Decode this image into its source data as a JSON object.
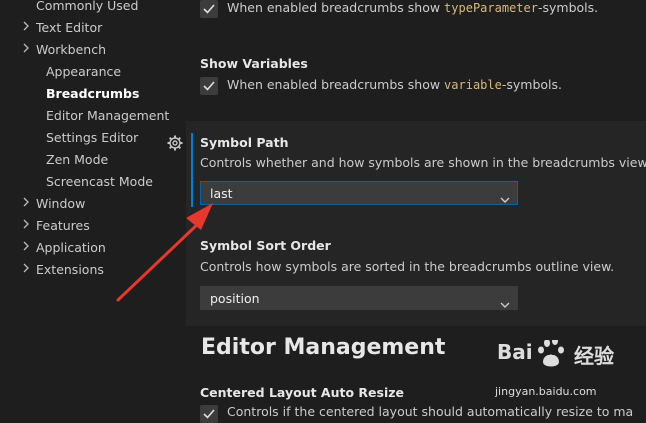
{
  "toc": {
    "items": [
      {
        "label": "Commonly Used",
        "indent": 1,
        "expandable": false
      },
      {
        "label": "Text Editor",
        "indent": 1,
        "expandable": true
      },
      {
        "label": "Workbench",
        "indent": 1,
        "expandable": true
      },
      {
        "label": "Appearance",
        "indent": 2,
        "expandable": false
      },
      {
        "label": "Breadcrumbs",
        "indent": 2,
        "expandable": false,
        "active": true
      },
      {
        "label": "Editor Management",
        "indent": 2,
        "expandable": false
      },
      {
        "label": "Settings Editor",
        "indent": 2,
        "expandable": false
      },
      {
        "label": "Zen Mode",
        "indent": 2,
        "expandable": false
      },
      {
        "label": "Screencast Mode",
        "indent": 2,
        "expandable": false
      },
      {
        "label": "Window",
        "indent": 1,
        "expandable": true
      },
      {
        "label": "Features",
        "indent": 1,
        "expandable": true
      },
      {
        "label": "Application",
        "indent": 1,
        "expandable": true
      },
      {
        "label": "Extensions",
        "indent": 1,
        "expandable": true
      }
    ],
    "chevron_right": "›",
    "chevron_down": "⌄"
  },
  "settings": {
    "type_param": {
      "desc_prefix": "When enabled breadcrumbs show ",
      "desc_code": "typeParameter",
      "desc_suffix": "-symbols.",
      "checked": true
    },
    "show_variables": {
      "title": "Show Variables",
      "desc_prefix": "When enabled breadcrumbs show ",
      "desc_code": "variable",
      "desc_suffix": "-symbols.",
      "checked": true
    },
    "symbol_path": {
      "title": "Symbol Path",
      "desc": "Controls whether and how symbols are shown in the breadcrumbs view.",
      "value": "last"
    },
    "symbol_sort_order": {
      "title": "Symbol Sort Order",
      "desc": "Controls how symbols are sorted in the breadcrumbs outline view.",
      "value": "position"
    },
    "editor_management_heading": "Editor Management",
    "centered_layout": {
      "title": "Centered Layout Auto Resize",
      "desc": "Controls if the centered layout should automatically resize to maximum"
    }
  },
  "colors": {
    "accent_blue": "#007fd4",
    "arrow_red": "#e8372d",
    "code_text": "#d7ba7d"
  },
  "watermark": {
    "brand_left": "Bai",
    "brand_paw": "du",
    "brand_cn": "经验",
    "url": "jingyan.baidu.com"
  }
}
